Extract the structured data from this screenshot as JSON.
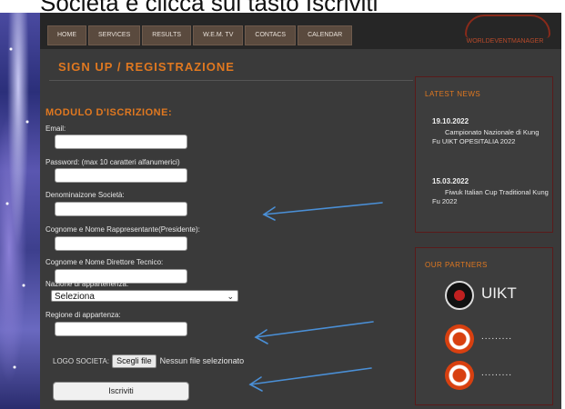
{
  "caption": "Società e clicca sul tasto Iscriviti",
  "nav": {
    "items": [
      "HOME",
      "SERVICES",
      "RESULTS",
      "W.E.M. TV",
      "CONTACS",
      "CALENDAR"
    ]
  },
  "logo_text": "WORLDEVENTMANAGER",
  "page_title": "SIGN UP / REGISTRAZIONE",
  "form": {
    "title": "MODULO D'ISCRIZIONE:",
    "email_label": "Email:",
    "password_label": "Password: (max 10 caratteri alfanumerici)",
    "company_label": "Denominaizone Società:",
    "president_label": "Cognome e Nome Rappresentante(Presidente):",
    "director_label": "Cognome e Nome Direttore Tecnico:",
    "nation_label": "Nazione di appartenenza:",
    "nation_value": "Seleziona",
    "region_label": "Regione di appartenza:",
    "logo_label": "LOGO SOCIETA:",
    "file_button": "Scegli file",
    "file_status": "Nessun file selezionato",
    "submit_label": "Iscriviti"
  },
  "news": {
    "title": "LATEST NEWS",
    "items": [
      {
        "date": "19.10.2022",
        "text": "Campionato Nazionale di Kung Fu UIKT OPESITALIA 2022"
      },
      {
        "date": "15.03.2022",
        "text": "Fiwuk Italian Cup Traditional Kung Fu 2022"
      }
    ]
  },
  "partners": {
    "title": "OUR PARTNERS",
    "uikt": "UIKT",
    "dots1": ".........",
    "dots2": "........."
  },
  "colors": {
    "accent": "#e07820",
    "page_bg": "#3a3a3a",
    "annotation_arrow": "#4a8fd6"
  }
}
